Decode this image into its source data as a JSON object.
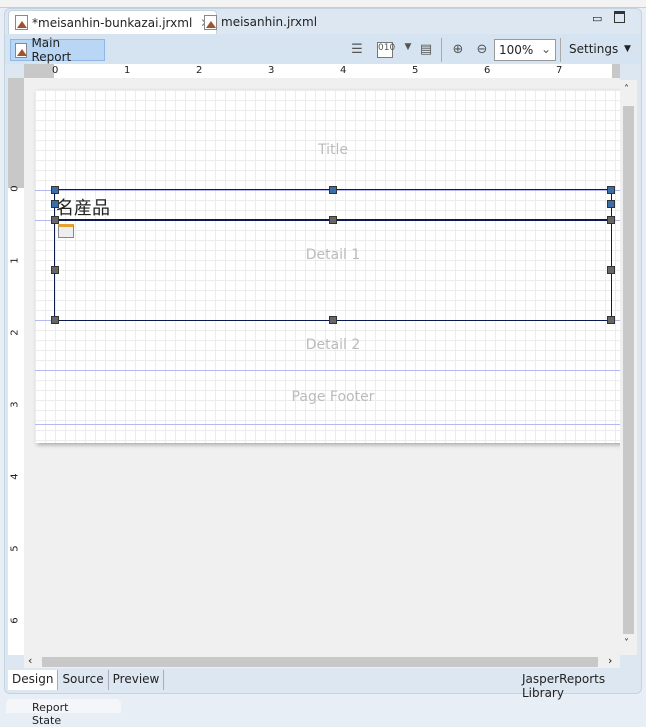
{
  "tabs": [
    {
      "label": "*meisanhin-bunkazai.jrxml",
      "active": true
    },
    {
      "label": "meisanhin.jrxml",
      "active": false
    }
  ],
  "toolbar": {
    "main_report": "Main Report",
    "zoom": "100%",
    "settings": "Settings"
  },
  "ruler": {
    "h": [
      "0",
      "1",
      "2",
      "3",
      "4",
      "5",
      "6",
      "7"
    ],
    "v": [
      "0",
      "1",
      "2",
      "3",
      "4",
      "5",
      "6"
    ]
  },
  "bands": {
    "title": "Title",
    "column_header_text": "名産品",
    "detail1": "Detail 1",
    "detail2": "Detail 2",
    "page_footer": "Page Footer"
  },
  "bottom_tabs": [
    "Design",
    "Source",
    "Preview"
  ],
  "library": "JasperReports Library",
  "bottom_view": "Report State"
}
